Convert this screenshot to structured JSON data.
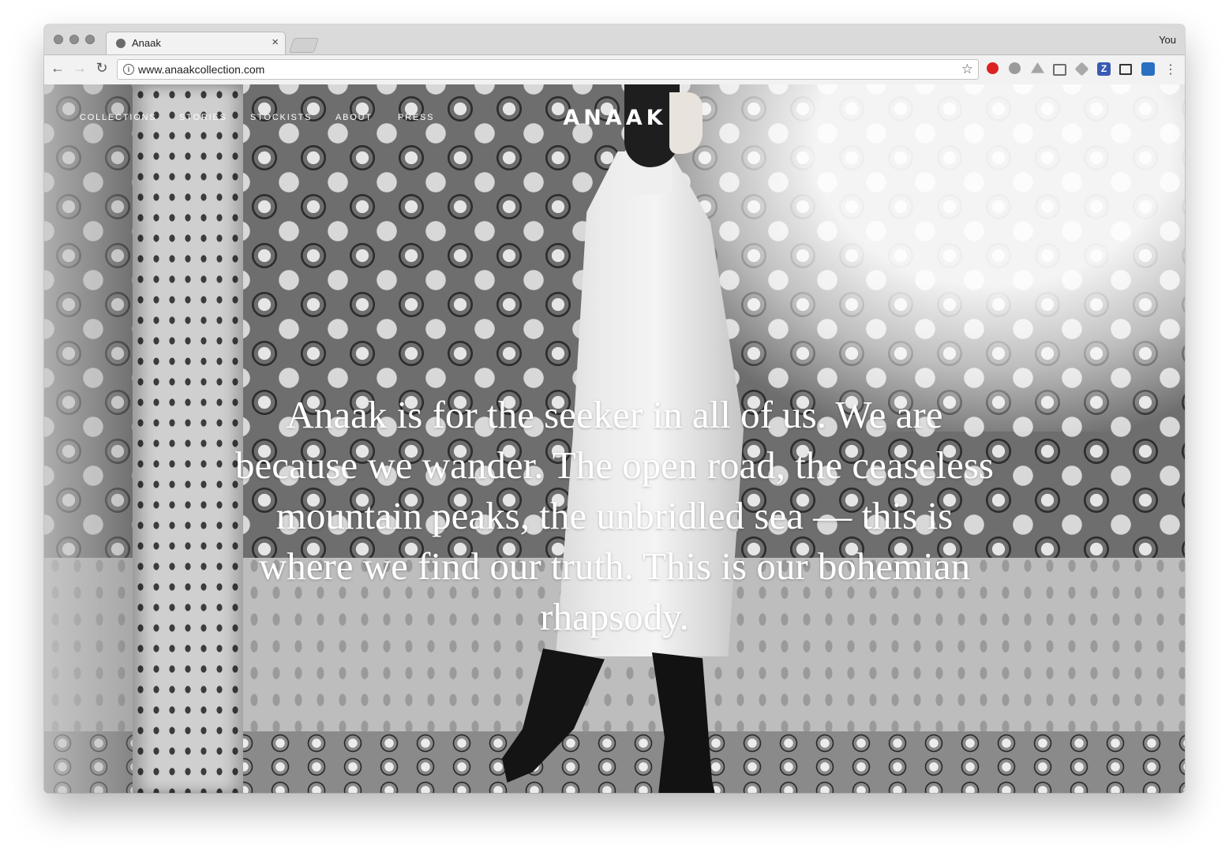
{
  "browser": {
    "tab_title": "Anaak",
    "tab_close": "×",
    "profile_name": "You",
    "url": "www.anaakcollection.com",
    "back_glyph": "←",
    "forward_glyph": "→",
    "reload_glyph": "↻",
    "info_glyph": "i",
    "star_glyph": "☆",
    "menu_glyph": "⋮",
    "extensions": [
      "opera-icon",
      "skype-icon",
      "drive-icon",
      "cast-icon",
      "dropbox-icon",
      "zotero-icon",
      "screenshot-icon",
      "news-icon"
    ]
  },
  "site": {
    "nav": [
      "COLLECTIONS",
      "STORIES",
      "STOCKISTS",
      "ABOUT",
      "PRESS"
    ],
    "logo": "ANAAK",
    "hero": "Anaak is for the seeker in all of us. We are because we wander. The open road, the ceaseless mountain peaks, the unbridled sea — this is where we find our truth. This is our bohemian rhapsody."
  },
  "colors": {
    "chrome_bg": "#dadada",
    "toolbar_bg": "#f2f2f2",
    "overlay_text": "#ffffff"
  }
}
